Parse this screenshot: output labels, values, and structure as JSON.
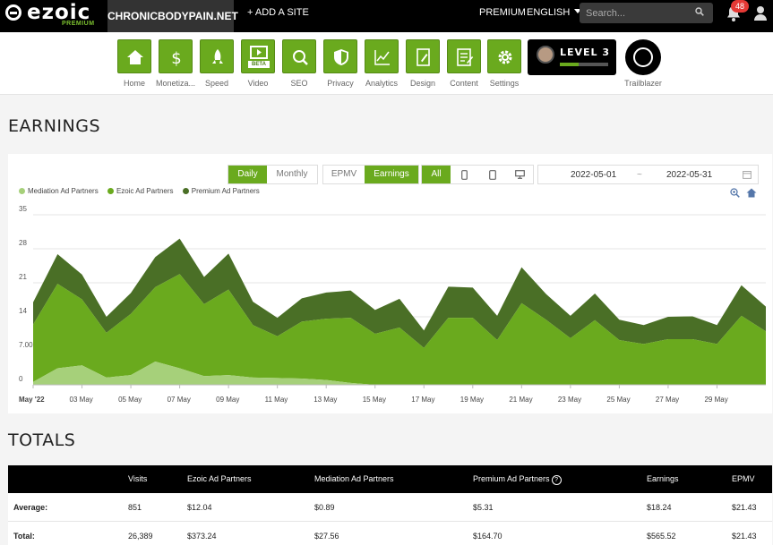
{
  "brand": {
    "name": "ezoic",
    "tier": "PREMIUM"
  },
  "topbar": {
    "site": "CHRONICBODYPAIN.NET",
    "add_site": "+ ADD A SITE",
    "premium": "PREMIUM",
    "language": "ENGLISH",
    "search_placeholder": "Search...",
    "notifications": "48"
  },
  "nav": [
    {
      "label": "Home",
      "icon": "home-icon"
    },
    {
      "label": "Monetiza...",
      "icon": "dollar-icon"
    },
    {
      "label": "Speed",
      "icon": "rocket-icon"
    },
    {
      "label": "Video",
      "icon": "video-icon",
      "badge": "BETA"
    },
    {
      "label": "SEO",
      "icon": "magnifier-icon"
    },
    {
      "label": "Privacy",
      "icon": "shield-icon"
    },
    {
      "label": "Analytics",
      "icon": "line-chart-icon"
    },
    {
      "label": "Design",
      "icon": "design-icon"
    },
    {
      "label": "Content",
      "icon": "document-icon"
    },
    {
      "label": "Settings",
      "icon": "gear-icon"
    }
  ],
  "level": {
    "label": "LEVEL 3",
    "progress": 0.38
  },
  "trailblazer": {
    "label": "Trailblazer"
  },
  "earnings": {
    "title": "EARNINGS",
    "period_buttons": [
      "Daily",
      "Monthly"
    ],
    "active_period": "Daily",
    "metric_buttons": [
      "EPMV",
      "Earnings"
    ],
    "active_metric": "Earnings",
    "device_all": "All",
    "date_start": "2022-05-01",
    "date_sep": "~",
    "date_end": "2022-05-31"
  },
  "colors": {
    "accent": "#6aaa1e",
    "mediation": "#a6d07a",
    "ezoic": "#6aaa1e",
    "premium": "#4a6f26"
  },
  "chart_data": {
    "type": "area",
    "stacked": true,
    "x": [
      "2022-05-01",
      "2022-05-02",
      "2022-05-03",
      "2022-05-04",
      "2022-05-05",
      "2022-05-06",
      "2022-05-07",
      "2022-05-08",
      "2022-05-09",
      "2022-05-10",
      "2022-05-11",
      "2022-05-12",
      "2022-05-13",
      "2022-05-14",
      "2022-05-15",
      "2022-05-16",
      "2022-05-17",
      "2022-05-18",
      "2022-05-19",
      "2022-05-20",
      "2022-05-21",
      "2022-05-22",
      "2022-05-23",
      "2022-05-24",
      "2022-05-25",
      "2022-05-26",
      "2022-05-27",
      "2022-05-28",
      "2022-05-29",
      "2022-05-30",
      "2022-05-31"
    ],
    "x_tick_labels": [
      "May '22",
      "03 May",
      "05 May",
      "07 May",
      "09 May",
      "11 May",
      "13 May",
      "15 May",
      "17 May",
      "19 May",
      "21 May",
      "23 May",
      "25 May",
      "27 May",
      "29 May"
    ],
    "y_ticks": [
      "0",
      "7.00",
      "14",
      "21",
      "28",
      "35"
    ],
    "ylim": [
      0,
      35
    ],
    "series": [
      {
        "name": "Mediation Ad Partners",
        "values": [
          0.6,
          3.4,
          4.0,
          1.5,
          2.0,
          4.8,
          3.4,
          1.8,
          2.0,
          1.5,
          1.4,
          1.3,
          1.0,
          0.4,
          0,
          0,
          0,
          0,
          0,
          0,
          0,
          0,
          0,
          0,
          0,
          0,
          0,
          0,
          0,
          0,
          0
        ]
      },
      {
        "name": "Ezoic Ad Partners",
        "values": [
          11.8,
          17.4,
          13.6,
          9.2,
          12.6,
          15.3,
          19.4,
          14.8,
          17.6,
          10.8,
          8.6,
          11.7,
          12.6,
          13.4,
          10.5,
          11.8,
          7.6,
          13.8,
          13.8,
          9.2,
          16.8,
          13.4,
          9.6,
          13.3,
          9.2,
          8.4,
          9.4,
          9.4,
          8.4,
          14.2,
          11.0
        ]
      },
      {
        "name": "Premium Ad Partners",
        "values": [
          4.6,
          6.1,
          5.1,
          3.3,
          4.3,
          6.2,
          7.3,
          5.6,
          7.4,
          4.8,
          3.8,
          4.8,
          5.4,
          5.6,
          4.9,
          5.9,
          3.6,
          6.4,
          6.2,
          5.0,
          7.4,
          5.3,
          4.6,
          5.5,
          4.2,
          3.9,
          4.6,
          4.7,
          3.9,
          6.3,
          5.1
        ]
      }
    ]
  },
  "totals": {
    "title": "TOTALS",
    "headers": [
      "",
      "Visits",
      "Ezoic Ad Partners",
      "Mediation Ad Partners",
      "Premium Ad Partners",
      "Earnings",
      "EPMV"
    ],
    "rows": [
      [
        "Average:",
        "851",
        "$12.04",
        "$0.89",
        "$5.31",
        "$18.24",
        "$21.43"
      ],
      [
        "Total:",
        "26,389",
        "$373.24",
        "$27.56",
        "$164.70",
        "$565.52",
        "$21.43"
      ]
    ]
  }
}
